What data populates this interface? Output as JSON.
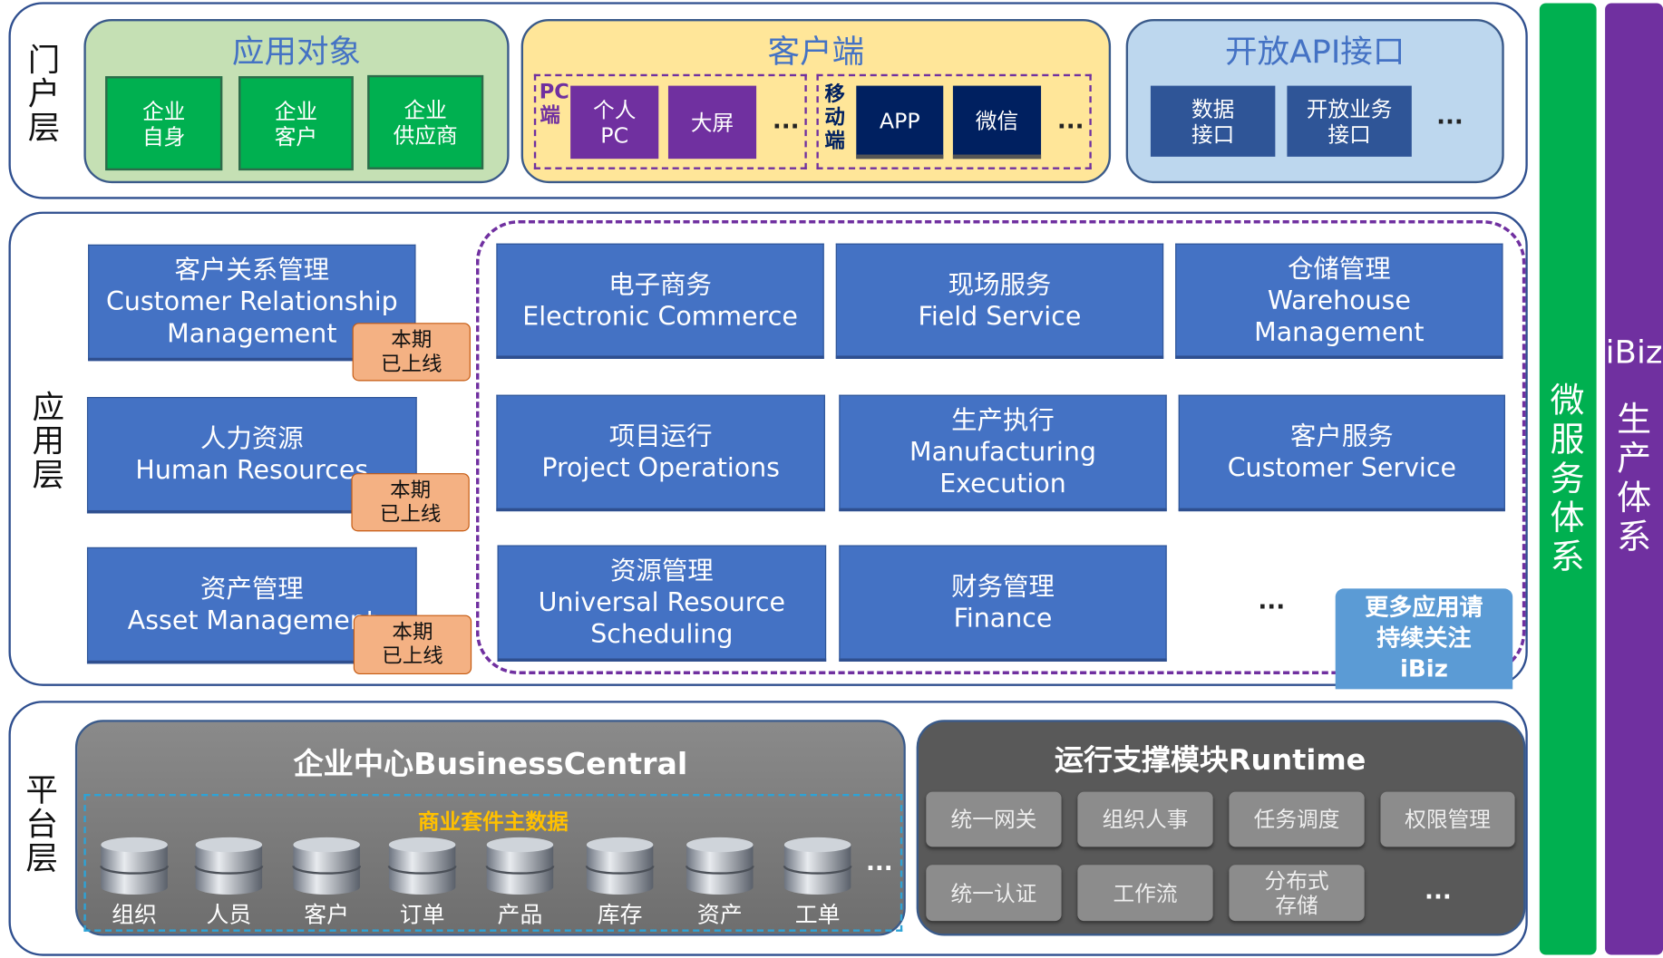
{
  "portal": {
    "label": "门户层",
    "app_objects": {
      "title": "应用对象",
      "items": [
        "企业\n自身",
        "企业\n客户",
        "企业\n供应商"
      ]
    },
    "client": {
      "title": "客户端",
      "pc_label": "PC端",
      "pc_items": [
        "个人\nPC",
        "大屏"
      ],
      "mobile_label": "移动端",
      "mobile_items": [
        "APP",
        "微信"
      ],
      "more": "..."
    },
    "api": {
      "title": "开放API接口",
      "items": [
        "数据\n接口",
        "开放业务\n接口"
      ],
      "more": "..."
    }
  },
  "application": {
    "label": "应用层",
    "launched": [
      {
        "name": "客户关系管理\nCustomer Relationship\nManagement",
        "badge": "本期\n已上线"
      },
      {
        "name": "人力资源\nHuman Resources",
        "badge": "本期\n已上线"
      },
      {
        "name": "资产管理\nAsset Management",
        "badge": "本期\n已上线"
      }
    ],
    "modules": [
      "电子商务\nElectronic Commerce",
      "现场服务\nField Service",
      "仓储管理\nWarehouse\nManagement",
      "项目运行\nProject Operations",
      "生产执行\nManufacturing\nExecution",
      "客户服务\nCustomer Service",
      "资源管理\nUniversal Resource\nScheduling",
      "财务管理\nFinance"
    ],
    "more": "...",
    "callout": "更多应用请\n持续关注\niBiz"
  },
  "platform": {
    "label": "平台层",
    "business_central": {
      "title": "企业中心BusinessCentral",
      "subtitle": "商业套件主数据",
      "items": [
        "组织",
        "人员",
        "客户",
        "订单",
        "产品",
        "库存",
        "资产",
        "工单"
      ],
      "more": "..."
    },
    "runtime": {
      "title": "运行支撑模块Runtime",
      "items": [
        "统一网关",
        "组织人事",
        "任务调度",
        "权限管理",
        "统一认证",
        "工作流",
        "分布式\n存储"
      ],
      "more": "..."
    }
  },
  "side": {
    "microservice": "微服务体系",
    "ibiz": "iBiz",
    "production": "生产体系"
  },
  "colors": {
    "green": "#00b050",
    "purple": "#7030a0",
    "navy": "#002060",
    "app_blue": "#4472c4",
    "badge": "#f4b183",
    "callout": "#5b9bd5"
  }
}
